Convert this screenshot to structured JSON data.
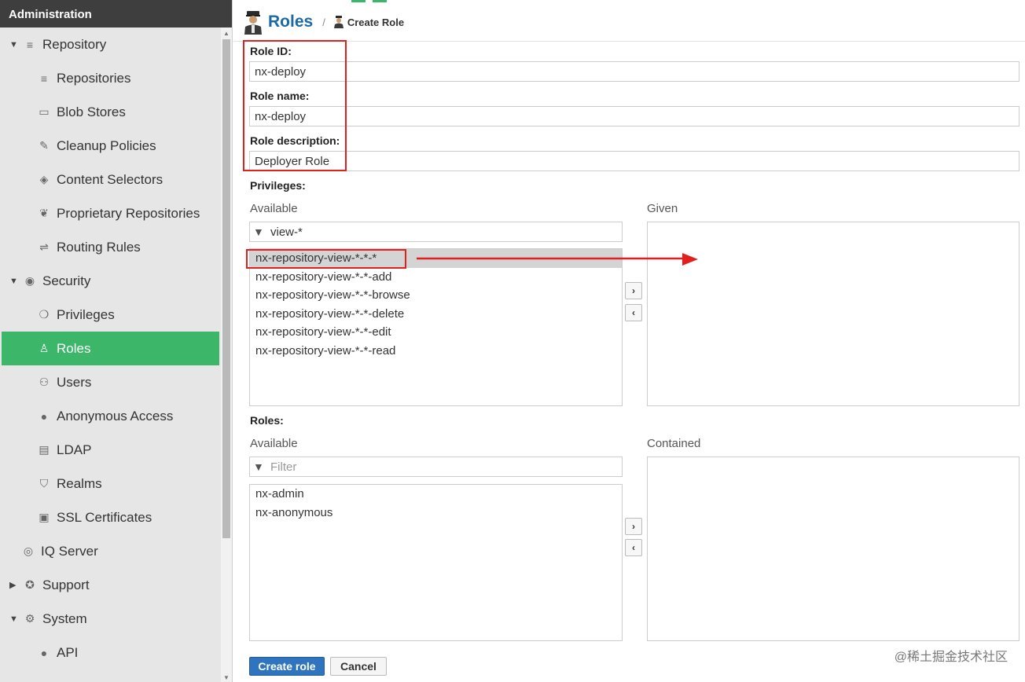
{
  "sidebar": {
    "title": "Administration",
    "items": [
      {
        "label": "Repository",
        "level": 0,
        "caret": "▼",
        "icon": "database-icon",
        "glyph": "≡"
      },
      {
        "label": "Repositories",
        "level": 1,
        "icon": "database-icon",
        "glyph": "≡"
      },
      {
        "label": "Blob Stores",
        "level": 1,
        "icon": "hard-drive-icon",
        "glyph": "▭"
      },
      {
        "label": "Cleanup Policies",
        "level": 1,
        "icon": "broom-icon",
        "glyph": "✎"
      },
      {
        "label": "Content Selectors",
        "level": 1,
        "icon": "layers-icon",
        "glyph": "◈"
      },
      {
        "label": "Proprietary Repositories",
        "level": 1,
        "icon": "repo-feet-icon",
        "glyph": "❦"
      },
      {
        "label": "Routing Rules",
        "level": 1,
        "icon": "signpost-icon",
        "glyph": "⇌"
      },
      {
        "label": "Security",
        "level": 0,
        "caret": "▼",
        "icon": "eye-icon",
        "glyph": "◉"
      },
      {
        "label": "Privileges",
        "level": 1,
        "icon": "medal-icon",
        "glyph": "❍"
      },
      {
        "label": "Roles",
        "level": 1,
        "icon": "officer-icon",
        "glyph": "♙",
        "selected": true
      },
      {
        "label": "Users",
        "level": 1,
        "icon": "users-icon",
        "glyph": "⚇"
      },
      {
        "label": "Anonymous Access",
        "level": 1,
        "icon": "user-icon",
        "glyph": "●"
      },
      {
        "label": "LDAP",
        "level": 1,
        "icon": "book-icon",
        "glyph": "▤"
      },
      {
        "label": "Realms",
        "level": 1,
        "icon": "shield-icon",
        "glyph": "⛉"
      },
      {
        "label": "SSL Certificates",
        "level": 1,
        "icon": "certificate-icon",
        "glyph": "▣"
      },
      {
        "label": "IQ Server",
        "level": 0,
        "icon": "iq-server-icon",
        "glyph": "◎"
      },
      {
        "label": "Support",
        "level": 0,
        "caret": "▶",
        "icon": "lifebuoy-icon",
        "glyph": "✪"
      },
      {
        "label": "System",
        "level": 0,
        "caret": "▼",
        "icon": "gear-icon",
        "glyph": "⚙"
      },
      {
        "label": "API",
        "level": 1,
        "icon": "api-icon",
        "glyph": "●"
      }
    ]
  },
  "breadcrumb": {
    "title": "Roles",
    "separator": "/",
    "current": "Create Role"
  },
  "form": {
    "role_id_label": "Role ID:",
    "role_id_value": "nx-deploy",
    "role_name_label": "Role name:",
    "role_name_value": "nx-deploy",
    "role_description_label": "Role description:",
    "role_description_value": "Deployer Role"
  },
  "privileges": {
    "label": "Privileges:",
    "available_label": "Available",
    "given_label": "Given",
    "filter_value": "view-*",
    "available": [
      "nx-repository-view-*-*-*",
      "nx-repository-view-*-*-add",
      "nx-repository-view-*-*-browse",
      "nx-repository-view-*-*-delete",
      "nx-repository-view-*-*-edit",
      "nx-repository-view-*-*-read"
    ],
    "add_label": "›",
    "remove_label": "‹"
  },
  "roles": {
    "label": "Roles:",
    "available_label": "Available",
    "contained_label": "Contained",
    "filter_placeholder": "Filter",
    "available": [
      "nx-admin",
      "nx-anonymous"
    ],
    "add_label": "›",
    "remove_label": "‹"
  },
  "actions": {
    "create_label": "Create role",
    "cancel_label": "Cancel"
  },
  "watermark": "@稀土掘金技术社区",
  "colors": {
    "accent_green": "#3cb668",
    "title_blue": "#1b6aa6",
    "primary_button": "#2f74be",
    "annotation_red": "#e0201f"
  }
}
